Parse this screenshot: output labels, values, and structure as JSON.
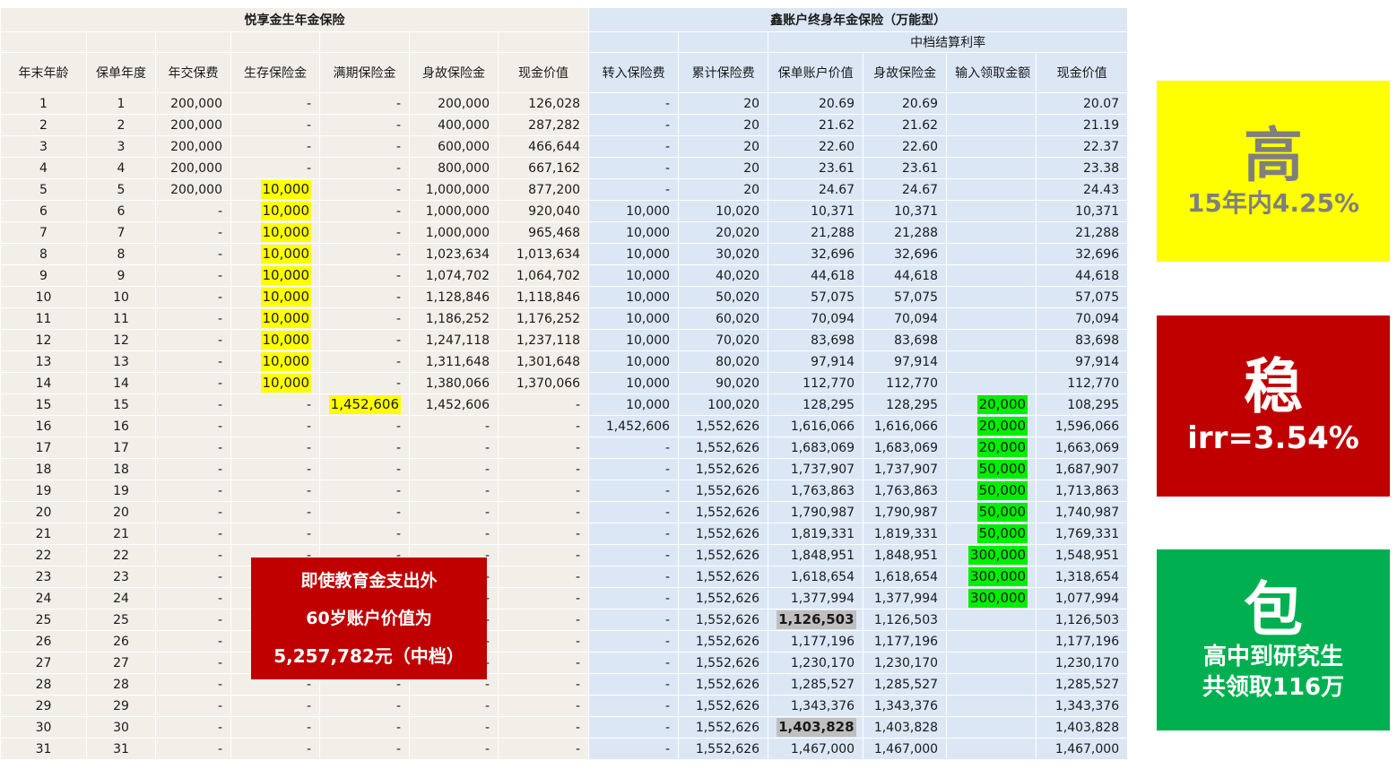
{
  "left_title": "悦享金生年金保险",
  "right_title": "鑫账户终身年金保险（万能型）",
  "right_subtitle": "中档结算利率",
  "headers": [
    "年末年龄",
    "保单年度",
    "年交保费",
    "生存保险金",
    "满期保险金",
    "身故保险金",
    "现金价值",
    "转入保险费",
    "累计保险费",
    "保单账户价值",
    "身故保险金",
    "输入领取金额",
    "现金价值"
  ],
  "rows": [
    [
      "1",
      "1",
      "200,000",
      "-",
      "-",
      "200,000",
      "126,028",
      "-",
      "20",
      "20.69",
      "20.69",
      "",
      "20.07"
    ],
    [
      "2",
      "2",
      "200,000",
      "-",
      "-",
      "400,000",
      "287,282",
      "-",
      "20",
      "21.62",
      "21.62",
      "",
      "21.19"
    ],
    [
      "3",
      "3",
      "200,000",
      "-",
      "-",
      "600,000",
      "466,644",
      "-",
      "20",
      "22.60",
      "22.60",
      "",
      "22.37"
    ],
    [
      "4",
      "4",
      "200,000",
      "-",
      "-",
      "800,000",
      "667,162",
      "-",
      "20",
      "23.61",
      "23.61",
      "",
      "23.38"
    ],
    [
      "5",
      "5",
      "200,000",
      "10,000",
      "-",
      "1,000,000",
      "877,200",
      "-",
      "20",
      "24.67",
      "24.67",
      "",
      "24.43"
    ],
    [
      "6",
      "6",
      "-",
      "10,000",
      "-",
      "1,000,000",
      "920,040",
      "10,000",
      "10,020",
      "10,371",
      "10,371",
      "",
      "10,371"
    ],
    [
      "7",
      "7",
      "-",
      "10,000",
      "-",
      "1,000,000",
      "965,468",
      "10,000",
      "20,020",
      "21,288",
      "21,288",
      "",
      "21,288"
    ],
    [
      "8",
      "8",
      "-",
      "10,000",
      "-",
      "1,023,634",
      "1,013,634",
      "10,000",
      "30,020",
      "32,696",
      "32,696",
      "",
      "32,696"
    ],
    [
      "9",
      "9",
      "-",
      "10,000",
      "-",
      "1,074,702",
      "1,064,702",
      "10,000",
      "40,020",
      "44,618",
      "44,618",
      "",
      "44,618"
    ],
    [
      "10",
      "10",
      "-",
      "10,000",
      "-",
      "1,128,846",
      "1,118,846",
      "10,000",
      "50,020",
      "57,075",
      "57,075",
      "",
      "57,075"
    ],
    [
      "11",
      "11",
      "-",
      "10,000",
      "-",
      "1,186,252",
      "1,176,252",
      "10,000",
      "60,020",
      "70,094",
      "70,094",
      "",
      "70,094"
    ],
    [
      "12",
      "12",
      "-",
      "10,000",
      "-",
      "1,247,118",
      "1,237,118",
      "10,000",
      "70,020",
      "83,698",
      "83,698",
      "",
      "83,698"
    ],
    [
      "13",
      "13",
      "-",
      "10,000",
      "-",
      "1,311,648",
      "1,301,648",
      "10,000",
      "80,020",
      "97,914",
      "97,914",
      "",
      "97,914"
    ],
    [
      "14",
      "14",
      "-",
      "10,000",
      "-",
      "1,380,066",
      "1,370,066",
      "10,000",
      "90,020",
      "112,770",
      "112,770",
      "",
      "112,770"
    ],
    [
      "15",
      "15",
      "-",
      "-",
      "1,452,606",
      "1,452,606",
      "-",
      "10,000",
      "100,020",
      "128,295",
      "128,295",
      "20,000",
      "108,295"
    ],
    [
      "16",
      "16",
      "-",
      "-",
      "-",
      "-",
      "-",
      "1,452,606",
      "1,552,626",
      "1,616,066",
      "1,616,066",
      "20,000",
      "1,596,066"
    ],
    [
      "17",
      "17",
      "-",
      "-",
      "-",
      "-",
      "-",
      "-",
      "1,552,626",
      "1,683,069",
      "1,683,069",
      "20,000",
      "1,663,069"
    ],
    [
      "18",
      "18",
      "-",
      "-",
      "-",
      "-",
      "-",
      "-",
      "1,552,626",
      "1,737,907",
      "1,737,907",
      "50,000",
      "1,687,907"
    ],
    [
      "19",
      "19",
      "-",
      "-",
      "-",
      "-",
      "-",
      "-",
      "1,552,626",
      "1,763,863",
      "1,763,863",
      "50,000",
      "1,713,863"
    ],
    [
      "20",
      "20",
      "-",
      "-",
      "-",
      "-",
      "-",
      "-",
      "1,552,626",
      "1,790,987",
      "1,790,987",
      "50,000",
      "1,740,987"
    ],
    [
      "21",
      "21",
      "-",
      "-",
      "-",
      "-",
      "-",
      "-",
      "1,552,626",
      "1,819,331",
      "1,819,331",
      "50,000",
      "1,769,331"
    ],
    [
      "22",
      "22",
      "-",
      "-",
      "-",
      "-",
      "-",
      "-",
      "1,552,626",
      "1,848,951",
      "1,848,951",
      "300,000",
      "1,548,951"
    ],
    [
      "23",
      "23",
      "-",
      "-",
      "-",
      "-",
      "-",
      "-",
      "1,552,626",
      "1,618,654",
      "1,618,654",
      "300,000",
      "1,318,654"
    ],
    [
      "24",
      "24",
      "-",
      "-",
      "-",
      "-",
      "-",
      "-",
      "1,552,626",
      "1,377,994",
      "1,377,994",
      "300,000",
      "1,077,994"
    ],
    [
      "25",
      "25",
      "-",
      "-",
      "-",
      "-",
      "-",
      "-",
      "1,552,626",
      "1,126,503",
      "1,126,503",
      "",
      "1,126,503"
    ],
    [
      "26",
      "26",
      "-",
      "-",
      "-",
      "-",
      "-",
      "-",
      "1,552,626",
      "1,177,196",
      "1,177,196",
      "",
      "1,177,196"
    ],
    [
      "27",
      "27",
      "-",
      "-",
      "-",
      "-",
      "-",
      "-",
      "1,552,626",
      "1,230,170",
      "1,230,170",
      "",
      "1,230,170"
    ],
    [
      "28",
      "28",
      "-",
      "-",
      "-",
      "-",
      "-",
      "-",
      "1,552,626",
      "1,285,527",
      "1,285,527",
      "",
      "1,285,527"
    ],
    [
      "29",
      "29",
      "-",
      "-",
      "-",
      "-",
      "-",
      "-",
      "1,552,626",
      "1,343,376",
      "1,343,376",
      "",
      "1,343,376"
    ],
    [
      "30",
      "30",
      "-",
      "-",
      "-",
      "-",
      "-",
      "-",
      "1,552,626",
      "1,403,828",
      "1,403,828",
      "",
      "1,403,828"
    ],
    [
      "31",
      "31",
      "-",
      "-",
      "-",
      "-",
      "-",
      "-",
      "1,552,626",
      "1,467,000",
      "1,467,000",
      "",
      "1,467,000"
    ]
  ],
  "highlights": [
    {
      "row": 4,
      "col": 3,
      "color": "yellow"
    },
    {
      "row": 5,
      "col": 3,
      "color": "yellow"
    },
    {
      "row": 6,
      "col": 3,
      "color": "yellow"
    },
    {
      "row": 7,
      "col": 3,
      "color": "yellow"
    },
    {
      "row": 8,
      "col": 3,
      "color": "yellow"
    },
    {
      "row": 9,
      "col": 3,
      "color": "yellow"
    },
    {
      "row": 10,
      "col": 3,
      "color": "yellow"
    },
    {
      "row": 11,
      "col": 3,
      "color": "yellow"
    },
    {
      "row": 12,
      "col": 3,
      "color": "yellow"
    },
    {
      "row": 13,
      "col": 3,
      "color": "yellow"
    },
    {
      "row": 14,
      "col": 4,
      "color": "yellow"
    },
    {
      "row": 14,
      "col": 11,
      "color": "green"
    },
    {
      "row": 15,
      "col": 11,
      "color": "green"
    },
    {
      "row": 16,
      "col": 11,
      "color": "green"
    },
    {
      "row": 17,
      "col": 11,
      "color": "green"
    },
    {
      "row": 18,
      "col": 11,
      "color": "green"
    },
    {
      "row": 19,
      "col": 11,
      "color": "green"
    },
    {
      "row": 20,
      "col": 11,
      "color": "green"
    },
    {
      "row": 21,
      "col": 11,
      "color": "green"
    },
    {
      "row": 22,
      "col": 11,
      "color": "green"
    },
    {
      "row": 23,
      "col": 11,
      "color": "green"
    },
    {
      "row": 24,
      "col": 9,
      "color": "gray"
    },
    {
      "row": 29,
      "col": 9,
      "color": "gray"
    }
  ],
  "callout": {
    "line1": "即使教育金支出外",
    "line2": "60岁账户价值为",
    "line3": "5,257,782元（中档）"
  },
  "cards": {
    "high": {
      "big": "高",
      "text": "15年内4.25%"
    },
    "stable": {
      "big": "稳",
      "text": "irr=3.54%"
    },
    "guarantee": {
      "big": "包",
      "text1": "高中到研究生",
      "text2": "共领取116万"
    }
  },
  "colors": {
    "left_bg": "#f2efe9",
    "right_bg": "#dbe7f5",
    "yellow": "#ffff00",
    "green": "#00ee00",
    "gray": "#bfbfbf",
    "red": "#c00000",
    "card_green": "#00b050"
  }
}
